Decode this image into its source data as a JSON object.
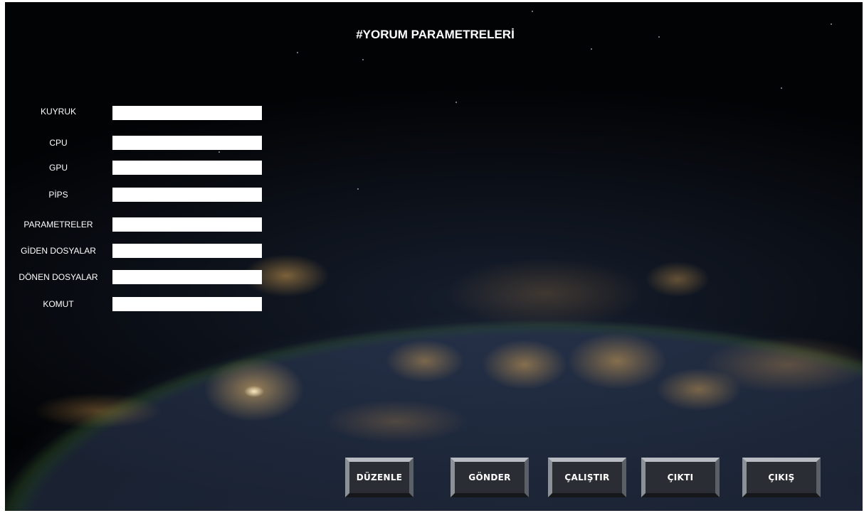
{
  "header": {
    "title": "#YORUM PARAMETRELERİ"
  },
  "form": {
    "fields": [
      {
        "label": "KUYRUK",
        "value": ""
      },
      {
        "label": "CPU",
        "value": ""
      },
      {
        "label": "GPU",
        "value": ""
      },
      {
        "label": "PİPS",
        "value": ""
      },
      {
        "label": "PARAMETRELER",
        "value": ""
      },
      {
        "label": "GİDEN DOSYALAR",
        "value": ""
      },
      {
        "label": "DÖNEN DOSYALAR",
        "value": ""
      },
      {
        "label": "KOMUT",
        "value": ""
      }
    ]
  },
  "toolbar": {
    "buttons": [
      {
        "label": "DÜZENLE"
      },
      {
        "label": "GÖNDER"
      },
      {
        "label": "ÇALIŞTIR"
      },
      {
        "label": "ÇIKTI"
      },
      {
        "label": "ÇIKIŞ"
      }
    ]
  },
  "theme": {
    "background": "#020305",
    "input_background": "#ffffff",
    "button_face": "#2a2d33",
    "text": "#ffffff"
  }
}
